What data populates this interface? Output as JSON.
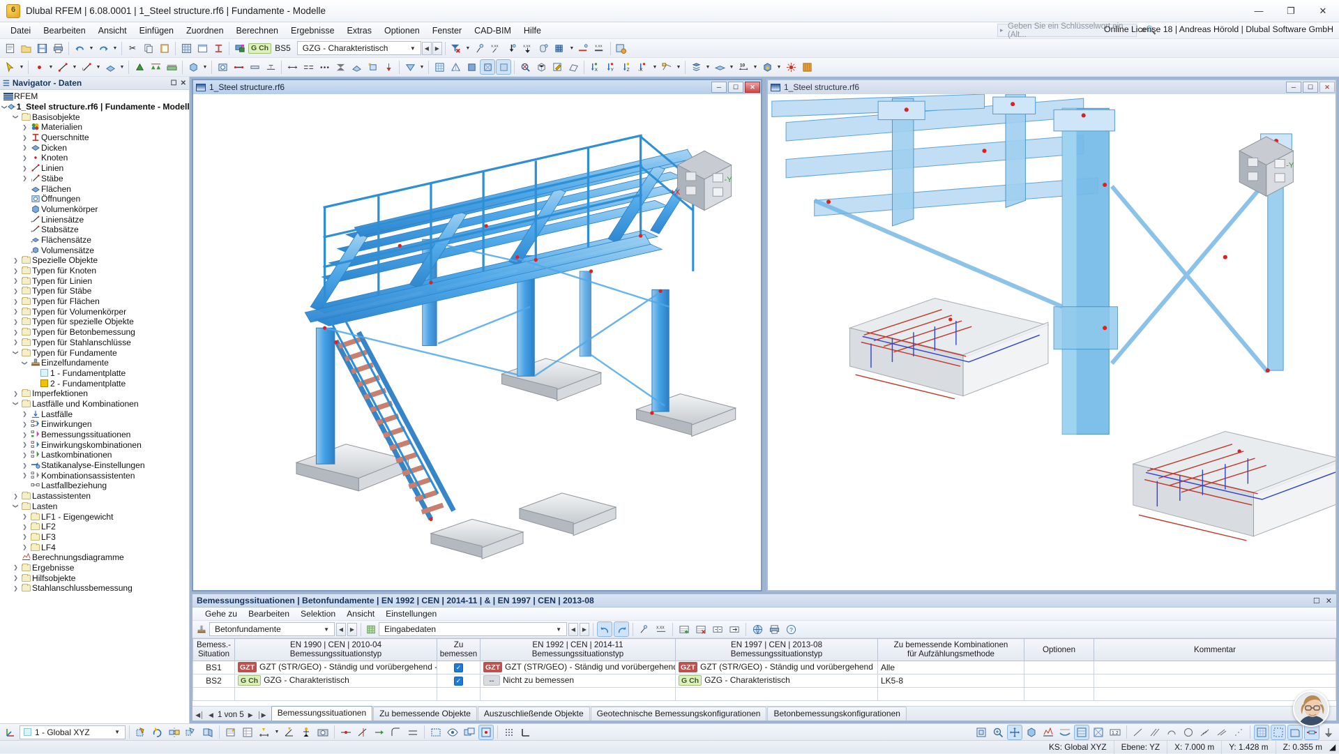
{
  "window": {
    "title": "Dlubal RFEM | 6.08.0001 | 1_Steel structure.rf6 | Fundamente - Modelle",
    "minimize": "—",
    "maximize": "❐",
    "close": "✕"
  },
  "menu": {
    "items": [
      "Datei",
      "Bearbeiten",
      "Ansicht",
      "Einfügen",
      "Zuordnen",
      "Berechnen",
      "Ergebnisse",
      "Extras",
      "Optionen",
      "Fenster",
      "CAD-BIM",
      "Hilfe"
    ],
    "search_placeholder": "Geben Sie ein Schlüsselwort ein (Alt...",
    "license": "Online License 18 | Andreas Hörold | Dlubal Software GmbH"
  },
  "toolbar1": {
    "load_tag": "G Ch",
    "load_case": "BS5",
    "load_desc": "GZG - Charakteristisch",
    "zoom_value": "10"
  },
  "navigator": {
    "header": "Navigator - Daten",
    "root": "RFEM",
    "tree": [
      {
        "level": 1,
        "label": "1_Steel structure.rf6 | Fundamente - Modelle",
        "icon": "model-icon",
        "twisty": "open",
        "bold": true
      },
      {
        "level": 2,
        "label": "Basisobjekte",
        "icon": "folder",
        "twisty": "open"
      },
      {
        "level": 3,
        "label": "Materialien",
        "icon": "materials-icon",
        "twisty": "closed"
      },
      {
        "level": 3,
        "label": "Querschnitte",
        "icon": "section-icon",
        "twisty": "closed"
      },
      {
        "level": 3,
        "label": "Dicken",
        "icon": "thickness-icon",
        "twisty": "closed"
      },
      {
        "level": 3,
        "label": "Knoten",
        "icon": "node-icon",
        "twisty": "closed"
      },
      {
        "level": 3,
        "label": "Linien",
        "icon": "line-icon",
        "twisty": "closed"
      },
      {
        "level": 3,
        "label": "Stäbe",
        "icon": "member-icon",
        "twisty": "closed"
      },
      {
        "level": 3,
        "label": "Flächen",
        "icon": "surface-icon",
        "twisty": "none"
      },
      {
        "level": 3,
        "label": "Öffnungen",
        "icon": "opening-icon",
        "twisty": "none"
      },
      {
        "level": 3,
        "label": "Volumenkörper",
        "icon": "solid-icon",
        "twisty": "none"
      },
      {
        "level": 3,
        "label": "Liniensätze",
        "icon": "lineset-icon",
        "twisty": "none"
      },
      {
        "level": 3,
        "label": "Stabsätze",
        "icon": "memberset-icon",
        "twisty": "none"
      },
      {
        "level": 3,
        "label": "Flächensätze",
        "icon": "surfaceset-icon",
        "twisty": "none"
      },
      {
        "level": 3,
        "label": "Volumensätze",
        "icon": "solidset-icon",
        "twisty": "none"
      },
      {
        "level": 2,
        "label": "Spezielle Objekte",
        "icon": "folder",
        "twisty": "closed"
      },
      {
        "level": 2,
        "label": "Typen für Knoten",
        "icon": "folder",
        "twisty": "closed"
      },
      {
        "level": 2,
        "label": "Typen für Linien",
        "icon": "folder",
        "twisty": "closed"
      },
      {
        "level": 2,
        "label": "Typen für Stäbe",
        "icon": "folder",
        "twisty": "closed"
      },
      {
        "level": 2,
        "label": "Typen für Flächen",
        "icon": "folder",
        "twisty": "closed"
      },
      {
        "level": 2,
        "label": "Typen für Volumenkörper",
        "icon": "folder",
        "twisty": "closed"
      },
      {
        "level": 2,
        "label": "Typen für spezielle Objekte",
        "icon": "folder",
        "twisty": "closed"
      },
      {
        "level": 2,
        "label": "Typen für Betonbemessung",
        "icon": "folder",
        "twisty": "closed"
      },
      {
        "level": 2,
        "label": "Typen für Stahlanschlüsse",
        "icon": "folder",
        "twisty": "closed"
      },
      {
        "level": 2,
        "label": "Typen für Fundamente",
        "icon": "folder",
        "twisty": "open"
      },
      {
        "level": 3,
        "label": "Einzelfundamente",
        "icon": "footing-icon",
        "twisty": "open"
      },
      {
        "level": 4,
        "label": "1 - Fundamentplatte",
        "icon": "swatch-cyan",
        "twisty": "none"
      },
      {
        "level": 4,
        "label": "2 - Fundamentplatte",
        "icon": "swatch-yellow",
        "twisty": "none"
      },
      {
        "level": 2,
        "label": "Imperfektionen",
        "icon": "folder",
        "twisty": "closed"
      },
      {
        "level": 2,
        "label": "Lastfälle und Kombinationen",
        "icon": "folder",
        "twisty": "open"
      },
      {
        "level": 3,
        "label": "Lastfälle",
        "icon": "loadcase-icon",
        "twisty": "closed"
      },
      {
        "level": 3,
        "label": "Einwirkungen",
        "icon": "action-icon",
        "twisty": "closed"
      },
      {
        "level": 3,
        "label": "Bemessungssituationen",
        "icon": "designsit-icon",
        "twisty": "closed"
      },
      {
        "level": 3,
        "label": "Einwirkungskombinationen",
        "icon": "actioncombo-icon",
        "twisty": "closed"
      },
      {
        "level": 3,
        "label": "Lastkombinationen",
        "icon": "loadcombo-icon",
        "twisty": "closed"
      },
      {
        "level": 3,
        "label": "Statikanalyse-Einstellungen",
        "icon": "statics-icon",
        "twisty": "closed"
      },
      {
        "level": 3,
        "label": "Kombinationsassistenten",
        "icon": "combowizard-icon",
        "twisty": "closed"
      },
      {
        "level": 3,
        "label": "Lastfallbeziehung",
        "icon": "relation-icon",
        "twisty": "none"
      },
      {
        "level": 2,
        "label": "Lastassistenten",
        "icon": "folder",
        "twisty": "closed"
      },
      {
        "level": 2,
        "label": "Lasten",
        "icon": "folder",
        "twisty": "open"
      },
      {
        "level": 3,
        "label": "LF1 - Eigengewicht",
        "icon": "folder",
        "twisty": "closed"
      },
      {
        "level": 3,
        "label": "LF2",
        "icon": "folder",
        "twisty": "closed"
      },
      {
        "level": 3,
        "label": "LF3",
        "icon": "folder",
        "twisty": "closed"
      },
      {
        "level": 3,
        "label": "LF4",
        "icon": "folder",
        "twisty": "closed"
      },
      {
        "level": 2,
        "label": "Berechnungsdiagramme",
        "icon": "diagram-icon",
        "twisty": "none"
      },
      {
        "level": 2,
        "label": "Ergebnisse",
        "icon": "folder",
        "twisty": "closed"
      },
      {
        "level": 2,
        "label": "Hilfsobjekte",
        "icon": "folder",
        "twisty": "closed"
      },
      {
        "level": 2,
        "label": "Stahlanschlussbemessung",
        "icon": "folder",
        "twisty": "closed"
      }
    ]
  },
  "views": [
    {
      "title": "1_Steel structure.rf6",
      "active": true,
      "cube_labels": [
        "+X",
        "-Y"
      ]
    },
    {
      "title": "1_Steel structure.rf6",
      "active": false,
      "cube_labels": [
        "-Y"
      ]
    }
  ],
  "table_panel": {
    "title": "Bemessungssituationen | Betonfundamente | EN 1992 | CEN | 2014-11 | & | EN 1997 | CEN | 2013-08",
    "menu": [
      "Gehe zu",
      "Bearbeiten",
      "Selektion",
      "Ansicht",
      "Einstellungen"
    ],
    "combo_left": "Betonfundamente",
    "combo_right": "Eingabedaten",
    "headers": [
      {
        "line1": "Bemess.-",
        "line2": "Situation"
      },
      {
        "line1": "EN 1990 | CEN | 2010-04",
        "line2": "Bemessungssituationstyp"
      },
      {
        "line1": "Zu",
        "line2": "bemessen"
      },
      {
        "line1": "EN 1992 | CEN | 2014-11",
        "line2": "Bemessungssituationstyp"
      },
      {
        "line1": "EN 1997 | CEN | 2013-08",
        "line2": "Bemessungssituationstyp"
      },
      {
        "line1": "Zu bemessende Kombinationen",
        "line2": "für Aufzählungsmethode"
      },
      {
        "line1": "Optionen",
        "line2": ""
      },
      {
        "line1": "Kommentar",
        "line2": ""
      }
    ],
    "rows": [
      {
        "id": "BS1",
        "en1990_tag": "GZT",
        "en1990_tag_kind": "gzt",
        "en1990": "GZT (STR/GEO) - Ständig und vorübergehend - ...",
        "checked": true,
        "en1992_tag": "GZT",
        "en1992_tag_kind": "gzt",
        "en1992": "GZT (STR/GEO) - Ständig und vorübergehend",
        "en1997_tag": "GZT",
        "en1997_tag_kind": "gzt",
        "en1997": "GZT (STR/GEO) - Ständig und vorübergehend",
        "combos": "Alle",
        "options": "",
        "comment": ""
      },
      {
        "id": "BS2",
        "en1990_tag": "G Ch",
        "en1990_tag_kind": "gch",
        "en1990": "GZG - Charakteristisch",
        "checked": true,
        "en1992_tag": "--",
        "en1992_tag_kind": "none",
        "en1992": "Nicht zu bemessen",
        "en1997_tag": "G Ch",
        "en1997_tag_kind": "gch",
        "en1997": "GZG - Charakteristisch",
        "combos": "LK5-8",
        "options": "",
        "comment": ""
      }
    ],
    "pager": "1 von 5",
    "tabs": [
      {
        "label": "Bemessungssituationen",
        "selected": true
      },
      {
        "label": "Zu bemessende Objekte",
        "selected": false
      },
      {
        "label": "Auszuschließende Objekte",
        "selected": false
      },
      {
        "label": "Geotechnische Bemessungskonfigurationen",
        "selected": false
      },
      {
        "label": "Betonbemessungskonfigurationen",
        "selected": false
      }
    ]
  },
  "bottombar": {
    "cs_swatch_label": "1 - Global XYZ"
  },
  "statusbar": {
    "ks": "KS: Global XYZ",
    "ebene": "Ebene: YZ",
    "x": "X: 7.000 m",
    "y": "Y: 1.428 m",
    "z": "Z: 0.355 m"
  }
}
